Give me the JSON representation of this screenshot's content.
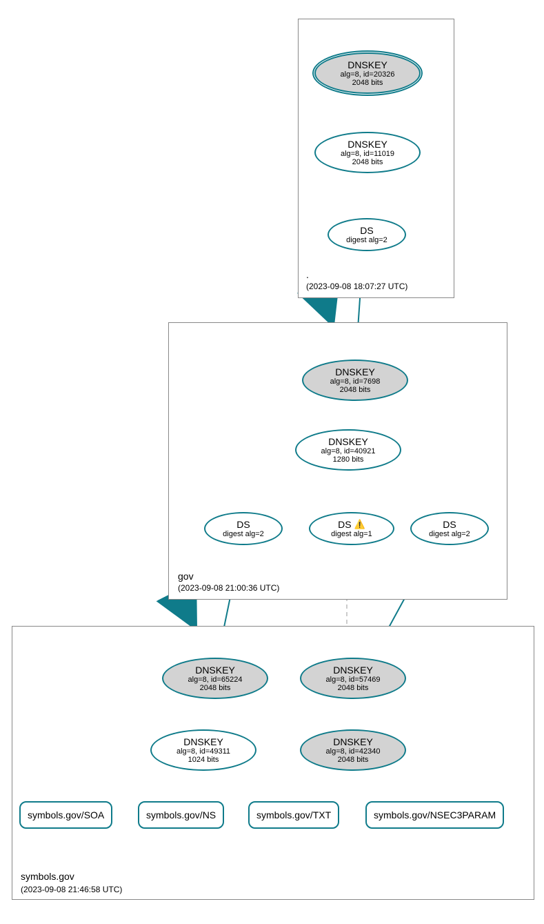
{
  "zones": {
    "root": {
      "label": ".",
      "ts": "(2023-09-08 18:07:27 UTC)"
    },
    "gov": {
      "label": "gov",
      "ts": "(2023-09-08 21:00:36 UTC)"
    },
    "symbols": {
      "label": "symbols.gov",
      "ts": "(2023-09-08 21:46:58 UTC)"
    }
  },
  "nodes": {
    "root_ksk": {
      "title": "DNSKEY",
      "sub1": "alg=8, id=20326",
      "sub2": "2048 bits"
    },
    "root_zsk": {
      "title": "DNSKEY",
      "sub1": "alg=8, id=11019",
      "sub2": "2048 bits"
    },
    "root_ds": {
      "title": "DS",
      "sub": "digest alg=2"
    },
    "gov_ksk": {
      "title": "DNSKEY",
      "sub1": "alg=8, id=7698",
      "sub2": "2048 bits"
    },
    "gov_zsk": {
      "title": "DNSKEY",
      "sub1": "alg=8, id=40921",
      "sub2": "1280 bits"
    },
    "gov_ds1": {
      "title": "DS",
      "sub": "digest alg=2"
    },
    "gov_ds2": {
      "title": "DS",
      "sub": "digest alg=1"
    },
    "gov_ds3": {
      "title": "DS",
      "sub": "digest alg=2"
    },
    "sym_ksk1": {
      "title": "DNSKEY",
      "sub1": "alg=8, id=65224",
      "sub2": "2048 bits"
    },
    "sym_ksk2": {
      "title": "DNSKEY",
      "sub1": "alg=8, id=57469",
      "sub2": "2048 bits"
    },
    "sym_zsk": {
      "title": "DNSKEY",
      "sub1": "alg=8, id=49311",
      "sub2": "1024 bits"
    },
    "sym_k3": {
      "title": "DNSKEY",
      "sub1": "alg=8, id=42340",
      "sub2": "2048 bits"
    },
    "rr_soa": {
      "label": "symbols.gov/SOA"
    },
    "rr_ns": {
      "label": "symbols.gov/NS"
    },
    "rr_txt": {
      "label": "symbols.gov/TXT"
    },
    "rr_nsec": {
      "label": "symbols.gov/NSEC3PARAM"
    }
  },
  "warn_icon": "⚠️"
}
